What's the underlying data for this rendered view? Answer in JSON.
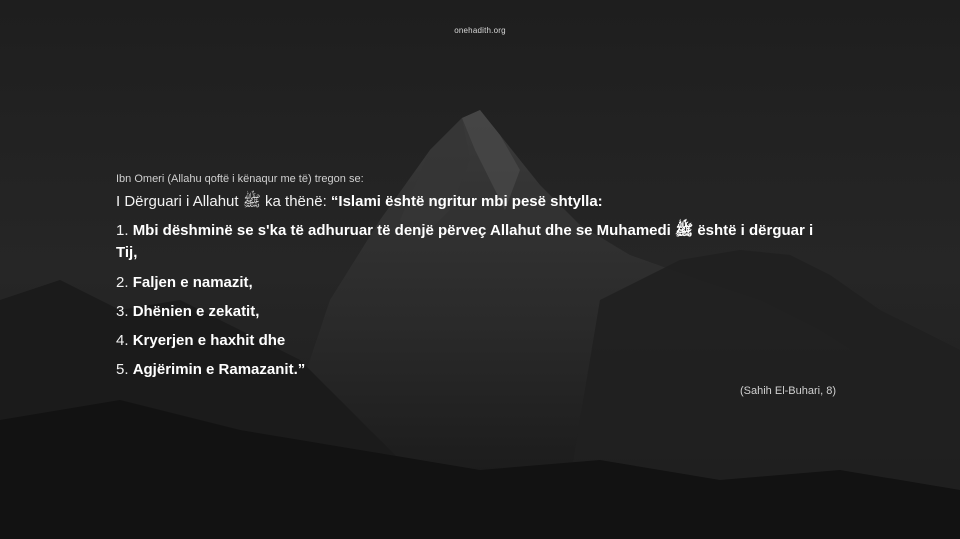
{
  "site": "onehadith.org",
  "narrator": "Ibn Omeri (Allahu qoftë i kënaqur me të) tregon se:",
  "intro": {
    "lead": "I Dërguari i Allahut ﷺ ka thënë: ",
    "quote": "“Islami është ngritur mbi pesë shtylla:"
  },
  "items": [
    {
      "num": "1. ",
      "text": "Mbi dëshminë se s'ka të adhuruar të denjë përveç Allahut dhe se Muhamedi ﷺ është i dërguar i Tij,"
    },
    {
      "num": "2. ",
      "text": "Faljen e namazit,"
    },
    {
      "num": "3. ",
      "text": "Dhënien e zekatit,"
    },
    {
      "num": "4. ",
      "text": "Kryerjen e haxhit dhe"
    },
    {
      "num": "5. ",
      "text": "Agjërimin e Ramazanit.”"
    }
  ],
  "source": "(Sahih El-Buhari, 8)"
}
